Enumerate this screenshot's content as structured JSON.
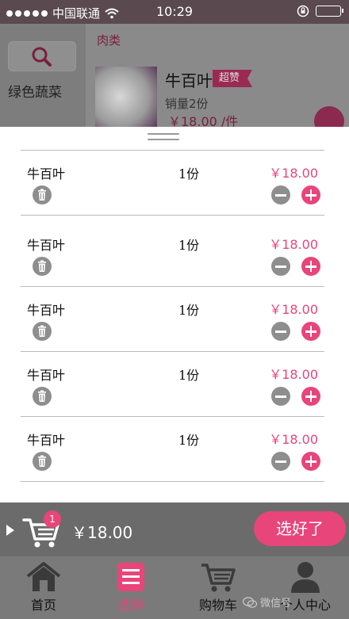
{
  "status_bar": {
    "carrier": "中国联通",
    "time": "10:29"
  },
  "background_page": {
    "category_veg": "绿色蔬菜",
    "category_meat": "肉类",
    "product": {
      "name": "牛百叶",
      "badge": "超赞",
      "sales": "销量2份",
      "price": "￥18.00 /件"
    }
  },
  "cart": {
    "items": [
      {
        "name": "牛百叶",
        "qty": "1份",
        "price": "￥18.00"
      },
      {
        "name": "牛百叶",
        "qty": "1份",
        "price": "￥18.00"
      },
      {
        "name": "牛百叶",
        "qty": "1份",
        "price": "￥18.00"
      },
      {
        "name": "牛百叶",
        "qty": "1份",
        "price": "￥18.00"
      },
      {
        "name": "牛百叶",
        "qty": "1份",
        "price": "￥18.00"
      }
    ]
  },
  "cart_bar": {
    "badge_count": "1",
    "total": "￥18.00",
    "done_label": "选好了"
  },
  "tabs": [
    {
      "label": "首页",
      "icon": "home-icon"
    },
    {
      "label": "选购",
      "icon": "list-icon"
    },
    {
      "label": "购物车",
      "icon": "cart-icon"
    },
    {
      "label": "个人中心",
      "icon": "user-icon"
    }
  ],
  "watermark": "微信号",
  "colors": {
    "accent": "#e8457a",
    "overlay": "#6b6b6b"
  }
}
